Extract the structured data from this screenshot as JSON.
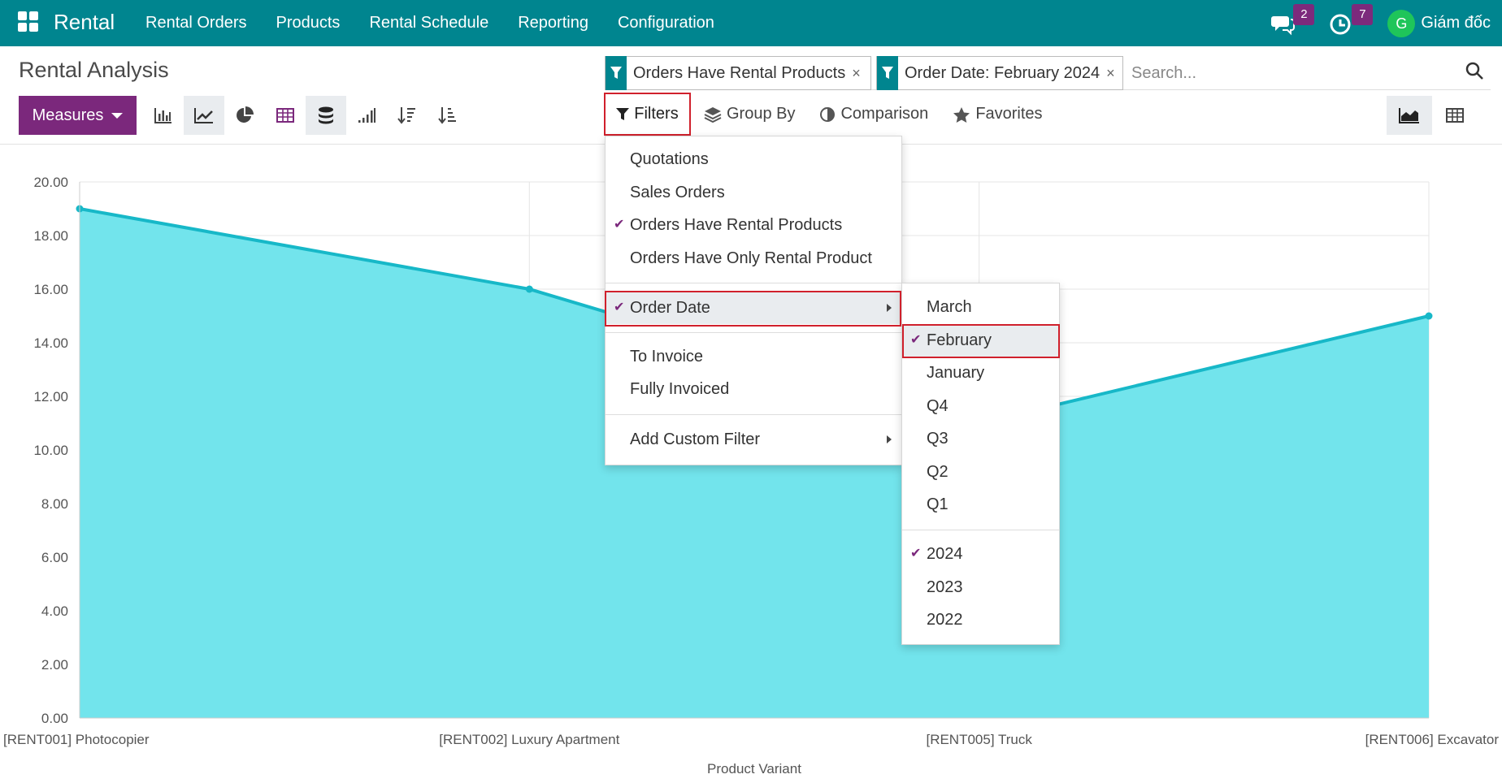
{
  "nav": {
    "app_name": "Rental",
    "menu": [
      "Rental Orders",
      "Products",
      "Rental Schedule",
      "Reporting",
      "Configuration"
    ],
    "messages_count": "2",
    "activities_count": "7",
    "avatar_letter": "G",
    "user_name": "Giám đốc"
  },
  "control_panel": {
    "title": "Rental Analysis",
    "measures_label": "Measures",
    "facets": [
      {
        "label": "Orders Have Rental Products",
        "icon": "filter-icon"
      },
      {
        "label": "Order Date: February 2024",
        "icon": "filter-icon"
      }
    ],
    "search_placeholder": "Search...",
    "filters_label": "Filters",
    "group_by_label": "Group By",
    "comparison_label": "Comparison",
    "favorites_label": "Favorites"
  },
  "filters_menu": {
    "items": [
      {
        "label": "Quotations",
        "checked": false
      },
      {
        "label": "Sales Orders",
        "checked": false
      },
      {
        "label": "Orders Have Rental Products",
        "checked": true
      },
      {
        "label": "Orders Have Only Rental Product",
        "checked": false
      },
      {
        "label": "Order Date",
        "checked": true,
        "submenu": true
      },
      {
        "label": "To Invoice",
        "checked": false
      },
      {
        "label": "Fully Invoiced",
        "checked": false
      },
      {
        "label": "Add Custom Filter",
        "checked": false,
        "submenu": true
      }
    ]
  },
  "order_date_menu": {
    "items": [
      {
        "label": "March",
        "checked": false
      },
      {
        "label": "February",
        "checked": true
      },
      {
        "label": "January",
        "checked": false
      },
      {
        "label": "Q4",
        "checked": false
      },
      {
        "label": "Q3",
        "checked": false
      },
      {
        "label": "Q2",
        "checked": false
      },
      {
        "label": "Q1",
        "checked": false
      },
      {
        "label": "2024",
        "checked": true
      },
      {
        "label": "2023",
        "checked": false
      },
      {
        "label": "2022",
        "checked": false
      }
    ]
  },
  "colors": {
    "navbar": "#00858f",
    "primary": "#7b287c",
    "area_fill": "#72e4ec",
    "line": "#17b8c8",
    "highlight_border": "#d0202c"
  },
  "chart_data": {
    "type": "area",
    "categories": [
      "[RENT001] Photocopier",
      "[RENT002] Luxury Apartment",
      "[RENT005] Truck",
      "[RENT006] Excavator"
    ],
    "values": [
      19,
      16,
      11,
      15
    ],
    "xlabel": "Product Variant",
    "ylabel": "",
    "ylim": [
      0,
      20
    ],
    "yticks": [
      "0.00",
      "2.00",
      "4.00",
      "6.00",
      "8.00",
      "10.00",
      "12.00",
      "14.00",
      "16.00",
      "18.00",
      "20.00"
    ],
    "grid": true
  }
}
